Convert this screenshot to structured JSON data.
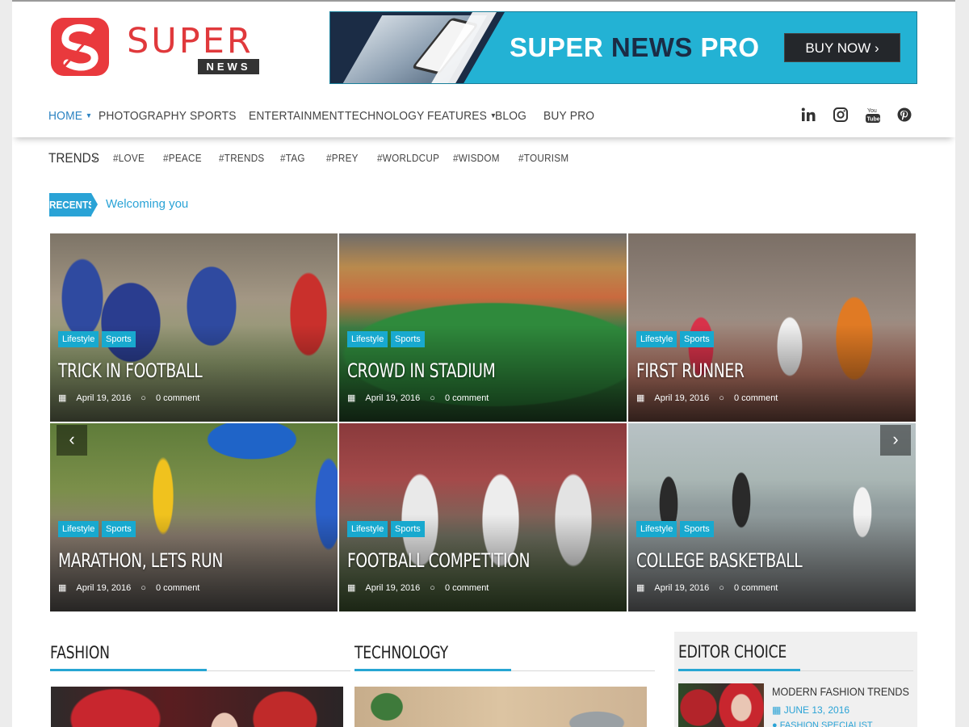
{
  "brand": {
    "logo_text": "SUPER",
    "logo_sub": "NEWS"
  },
  "banner": {
    "title_a": "SUPER ",
    "title_b": "NEWS",
    "title_c": " PRO",
    "button": "BUY NOW"
  },
  "nav": {
    "items": [
      "HOME",
      "PHOTOGRAPHY",
      "SPORTS",
      "ENTERTAINMENT",
      "TECHNOLOGY",
      "FEATURES",
      "BLOG",
      "BUY PRO"
    ]
  },
  "social": [
    "linkedin-icon",
    "instagram-icon",
    "youtube-icon",
    "pinterest-icon"
  ],
  "trends": {
    "label": "TRENDS",
    "tags": [
      "#LOVE",
      "#PEACE",
      "#TRENDS",
      "#TAG",
      "#PREY",
      "#WORLDCUP",
      "#WISDOM",
      "#TOURISM"
    ]
  },
  "recents": {
    "label": "RECENTS",
    "text": "Welcoming you"
  },
  "tiles": [
    {
      "title": "TRICK IN FOOTBALL",
      "cat1": "Lifestyle",
      "cat2": "Sports",
      "date": "April 19, 2016",
      "comments": "0 comment"
    },
    {
      "title": "CROWD IN STADIUM",
      "cat1": "Lifestyle",
      "cat2": "Sports",
      "date": "April 19, 2016",
      "comments": "0 comment"
    },
    {
      "title": "FIRST RUNNER",
      "cat1": "Lifestyle",
      "cat2": "Sports",
      "date": "April 19, 2016",
      "comments": "0 comment"
    },
    {
      "title": "MARATHON, LETS RUN",
      "cat1": "Lifestyle",
      "cat2": "Sports",
      "date": "April 19, 2016",
      "comments": "0 comment"
    },
    {
      "title": "FOOTBALL COMPETITION",
      "cat1": "Lifestyle",
      "cat2": "Sports",
      "date": "April 19, 2016",
      "comments": "0 comment"
    },
    {
      "title": "COLLEGE BASKETBALL",
      "cat1": "Lifestyle",
      "cat2": "Sports",
      "date": "April 19, 2016",
      "comments": "0 comment"
    }
  ],
  "sections": {
    "fashion": "FASHION",
    "technology": "TECHNOLOGY",
    "editor_choice": "EDITOR CHOICE"
  },
  "editor_item": {
    "title": "MODERN FASHION TRENDS",
    "date": "JUNE 13, 2016",
    "meta": "FASHION SPECIALIST"
  }
}
